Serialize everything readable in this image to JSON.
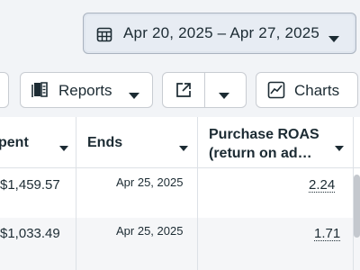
{
  "date_range": {
    "label": "Apr 20, 2025 – Apr 27, 2025",
    "icon": "calendar-icon"
  },
  "toolbar": {
    "reports_label": "Reports",
    "reports_icon": "reports-icon",
    "export_icon": "export-icon",
    "charts_label": "Charts",
    "charts_icon": "line-chart-icon"
  },
  "table": {
    "columns": [
      {
        "label": "pent"
      },
      {
        "label": "Ends"
      },
      {
        "label_line1": "Purchase ROAS",
        "label_line2": "(return on ad…"
      }
    ],
    "rows": [
      {
        "spent": "$1,459.57",
        "ends": "Apr 25, 2025",
        "roas": "2.24"
      },
      {
        "spent": "$1,033.49",
        "ends": "Apr 25, 2025",
        "roas": "1.71"
      }
    ]
  }
}
